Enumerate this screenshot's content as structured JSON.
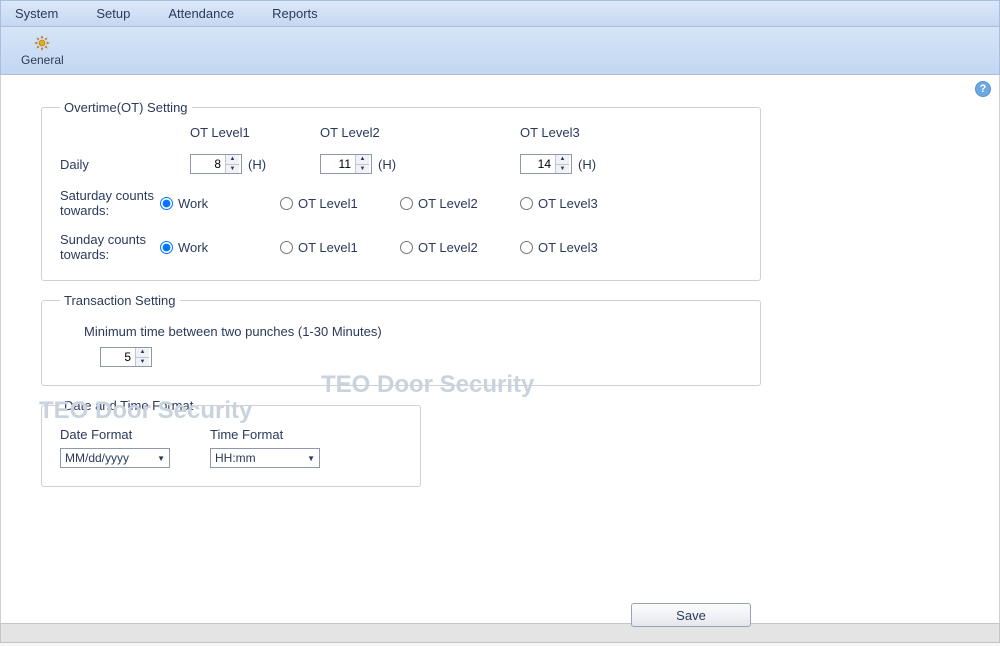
{
  "menu": {
    "system": "System",
    "setup": "Setup",
    "attendance": "Attendance",
    "reports": "Reports"
  },
  "toolbar": {
    "general": "General"
  },
  "help": "?",
  "watermark": "TEO Door Security",
  "ot": {
    "legend": "Overtime(OT) Setting",
    "headers": {
      "l1": "OT Level1",
      "l2": "OT Level2",
      "l3": "OT Level3"
    },
    "daily_label": "Daily",
    "unit": "(H)",
    "values": {
      "l1": "8",
      "l2": "11",
      "l3": "14"
    },
    "sat_label": "Saturday counts towards:",
    "sun_label": "Sunday counts towards:",
    "opts": {
      "work": "Work",
      "l1": "OT Level1",
      "l2": "OT Level2",
      "l3": "OT Level3"
    }
  },
  "trans": {
    "legend": "Transaction Setting",
    "note": "Minimum time between two punches (1-30 Minutes)",
    "value": "5"
  },
  "fmt": {
    "legend": "Date and Time Format",
    "date_label": "Date Format",
    "time_label": "Time Format",
    "date_value": "MM/dd/yyyy",
    "time_value": "HH:mm"
  },
  "save": "Save"
}
